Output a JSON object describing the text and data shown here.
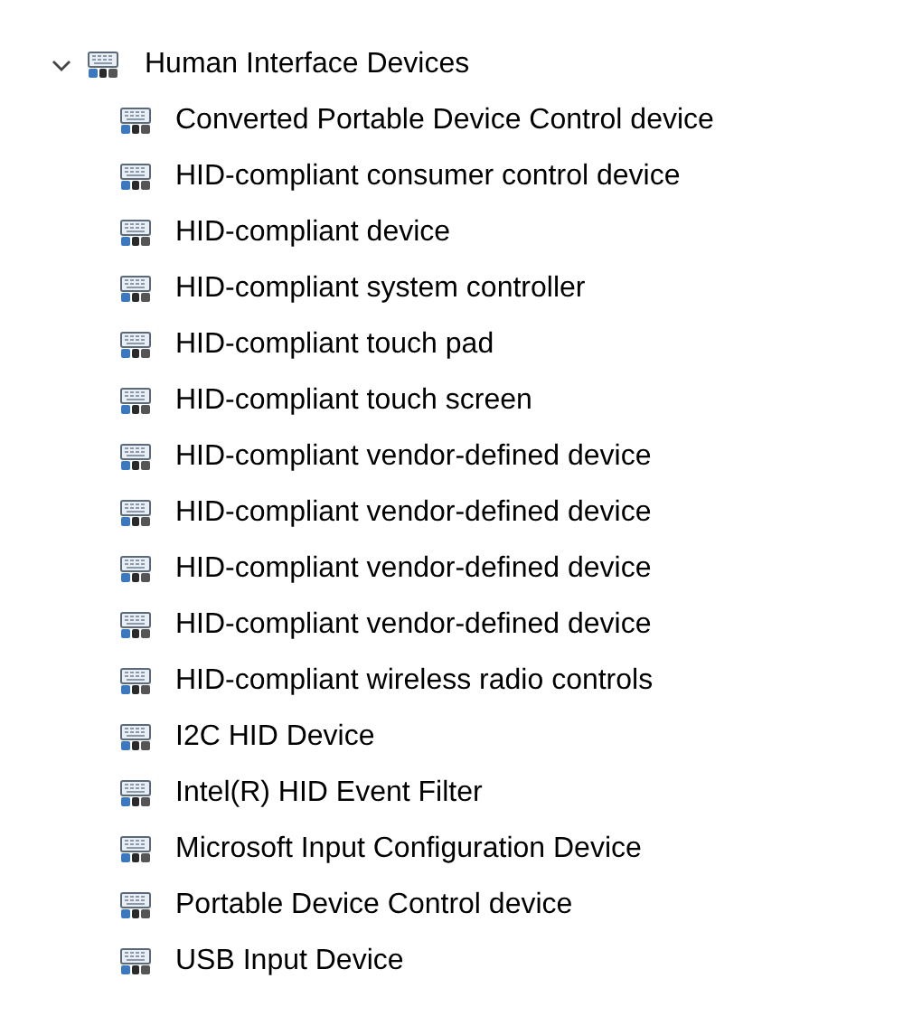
{
  "tree": {
    "label": "Human Interface Devices",
    "expanded": true,
    "children": [
      {
        "label": "Converted Portable Device Control device"
      },
      {
        "label": "HID-compliant consumer control device"
      },
      {
        "label": "HID-compliant device"
      },
      {
        "label": "HID-compliant system controller"
      },
      {
        "label": "HID-compliant touch pad"
      },
      {
        "label": "HID-compliant touch screen"
      },
      {
        "label": "HID-compliant vendor-defined device"
      },
      {
        "label": "HID-compliant vendor-defined device"
      },
      {
        "label": "HID-compliant vendor-defined device"
      },
      {
        "label": "HID-compliant vendor-defined device"
      },
      {
        "label": "HID-compliant wireless radio controls"
      },
      {
        "label": "I2C HID Device"
      },
      {
        "label": "Intel(R) HID Event Filter"
      },
      {
        "label": "Microsoft Input Configuration Device"
      },
      {
        "label": "Portable Device Control device"
      },
      {
        "label": "USB Input Device"
      }
    ]
  }
}
